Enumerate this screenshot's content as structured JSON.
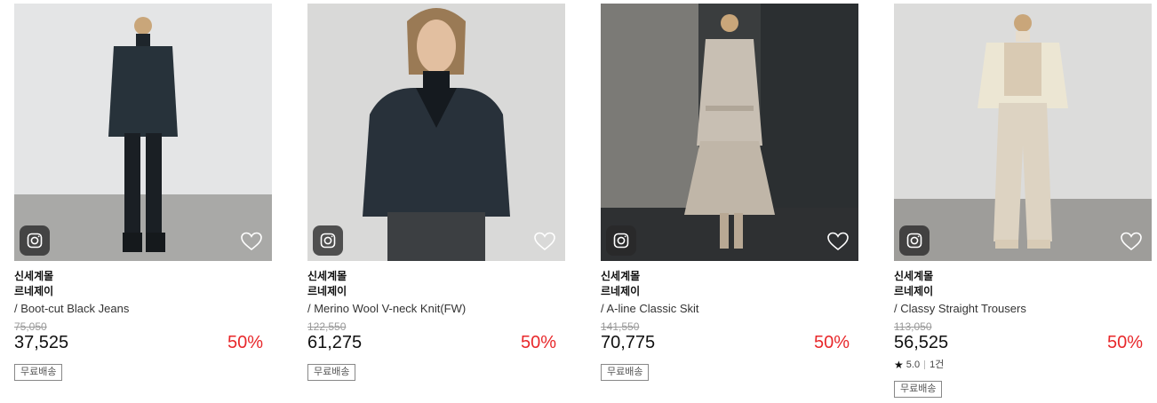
{
  "products": [
    {
      "mall": "신세계몰",
      "brand": "르네제이",
      "name": "/ Boot-cut Black Jeans",
      "original_price": "75,050",
      "price": "37,525",
      "discount": "50%",
      "badge": "무료배송"
    },
    {
      "mall": "신세계몰",
      "brand": "르네제이",
      "name": "/ Merino Wool V-neck Knit(FW)",
      "original_price": "122,550",
      "price": "61,275",
      "discount": "50%",
      "badge": "무료배송"
    },
    {
      "mall": "신세계몰",
      "brand": "르네제이",
      "name": "/ A-line Classic Skit",
      "original_price": "141,550",
      "price": "70,775",
      "discount": "50%",
      "badge": "무료배송"
    },
    {
      "mall": "신세계몰",
      "brand": "르네제이",
      "name": "/ Classy Straight Trousers",
      "original_price": "113,050",
      "price": "56,525",
      "discount": "50%",
      "rating": "5.0",
      "review_count": "1건",
      "badge": "무료배송"
    }
  ],
  "icons": {
    "camera": "camera-icon",
    "wishlist": "heart-icon",
    "star": "star-icon"
  },
  "colors": {
    "discount": "#e8282b",
    "text": "#111111",
    "strike": "#999999"
  }
}
